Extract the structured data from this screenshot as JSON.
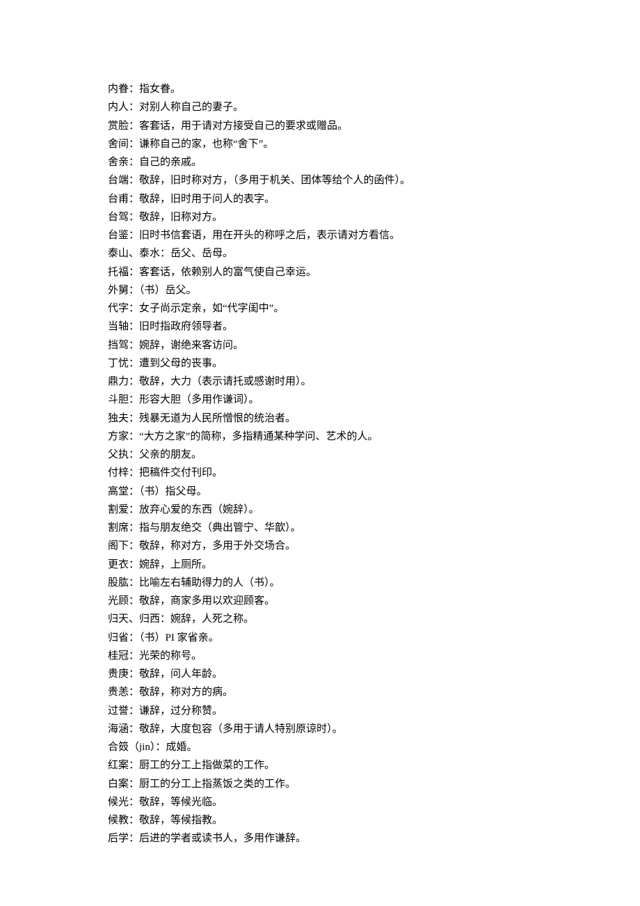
{
  "entries": [
    {
      "term": "内眷：",
      "def": "指女眷。"
    },
    {
      "term": "内人：",
      "def": "对别人称自己的妻子。"
    },
    {
      "term": "赏脸：",
      "def": "客套话，用于请对方接受自己的要求或赠品。"
    },
    {
      "term": "舍间：",
      "def": "谦称自己的家，也称“舍下”。"
    },
    {
      "term": "舍亲：",
      "def": "自己的亲戚。"
    },
    {
      "term": "台端：",
      "def": "敬辞，旧时称对方，（多用于机关、团体等给个人的函件）。"
    },
    {
      "term": "台甫：",
      "def": "敬辞，旧时用于问人的表字。"
    },
    {
      "term": "台驾：",
      "def": "敬辞，旧称对方。"
    },
    {
      "term": "台鉴：",
      "def": "旧时书信套语，用在开头的称呼之后，表示请对方看信。"
    },
    {
      "term": "泰山、泰水：",
      "def": "岳父、岳母。"
    },
    {
      "term": "托福：",
      "def": "客套话，依赖别人的富气使自己幸运。"
    },
    {
      "term": "外舅：",
      "def": "（书）岳父。"
    },
    {
      "term": "代字：",
      "def": "女子尚示定亲，如“代字闺中”。"
    },
    {
      "term": "当轴：",
      "def": "旧时指政府领导者。"
    },
    {
      "term": "挡驾：",
      "def": "婉辞，谢绝来客访问。"
    },
    {
      "term": "丁忧：",
      "def": "遭到父母的丧事。"
    },
    {
      "term": "鼎力：",
      "def": "敬辞，大力（表示请托或感谢时用）。"
    },
    {
      "term": "斗胆：",
      "def": "形容大胆（多用作谦词）。"
    },
    {
      "term": "独夫：",
      "def": "残暴无道为人民所憎恨的统治者。"
    },
    {
      "term": "方家：",
      "def": "“大方之家”的简称，多指精通某种学问、艺术的人。"
    },
    {
      "term": "父执：",
      "def": "父亲的朋友。"
    },
    {
      "term": "付梓：",
      "def": "把稿件交付刊印。"
    },
    {
      "term": "高堂：",
      "def": "（书）指父母。"
    },
    {
      "term": "割爱：",
      "def": "放弃心爱的东西（婉辞）。"
    },
    {
      "term": "割席：",
      "def": "指与朋友绝交（典出管宁、华歆）。"
    },
    {
      "term": "阁下：",
      "def": "敬辞，称对方，多用于外交场合。"
    },
    {
      "term": "更衣：",
      "def": "婉辞，上厕所。"
    },
    {
      "term": "股肱：",
      "def": "比喻左右辅助得力的人（书）。"
    },
    {
      "term": "光顾：",
      "def": "敬辞，商家多用以欢迎顾客。"
    },
    {
      "term": "归天、归西：",
      "def": "婉辞，人死之称。"
    },
    {
      "term": "归省：",
      "def": "（书）PI 家省亲。"
    },
    {
      "term": "桂冠：",
      "def": "光荣的称号。"
    },
    {
      "term": "贵庚：",
      "def": "敬辞，问人年龄。"
    },
    {
      "term": "贵恙：",
      "def": "敬辞，称对方的病。"
    },
    {
      "term": "过誉：",
      "def": "谦辞，过分称赞。"
    },
    {
      "term": "海涵：",
      "def": "敬辞，大度包容（多用于请人特别原谅时）。"
    },
    {
      "term": "合笯（jin）：",
      "def": "成婚。"
    },
    {
      "term": "红案：",
      "def": "厨工的分工上指做菜的工作。"
    },
    {
      "term": "白案：",
      "def": "厨工的分工上指蒸饭之类的工作。"
    },
    {
      "term": "候光：",
      "def": "敬辞，等候光临。"
    },
    {
      "term": "候教：",
      "def": "敬辞，等候指教。"
    },
    {
      "term": "后学：",
      "def": "后进的学者或读书人，多用作谦辞。"
    }
  ]
}
